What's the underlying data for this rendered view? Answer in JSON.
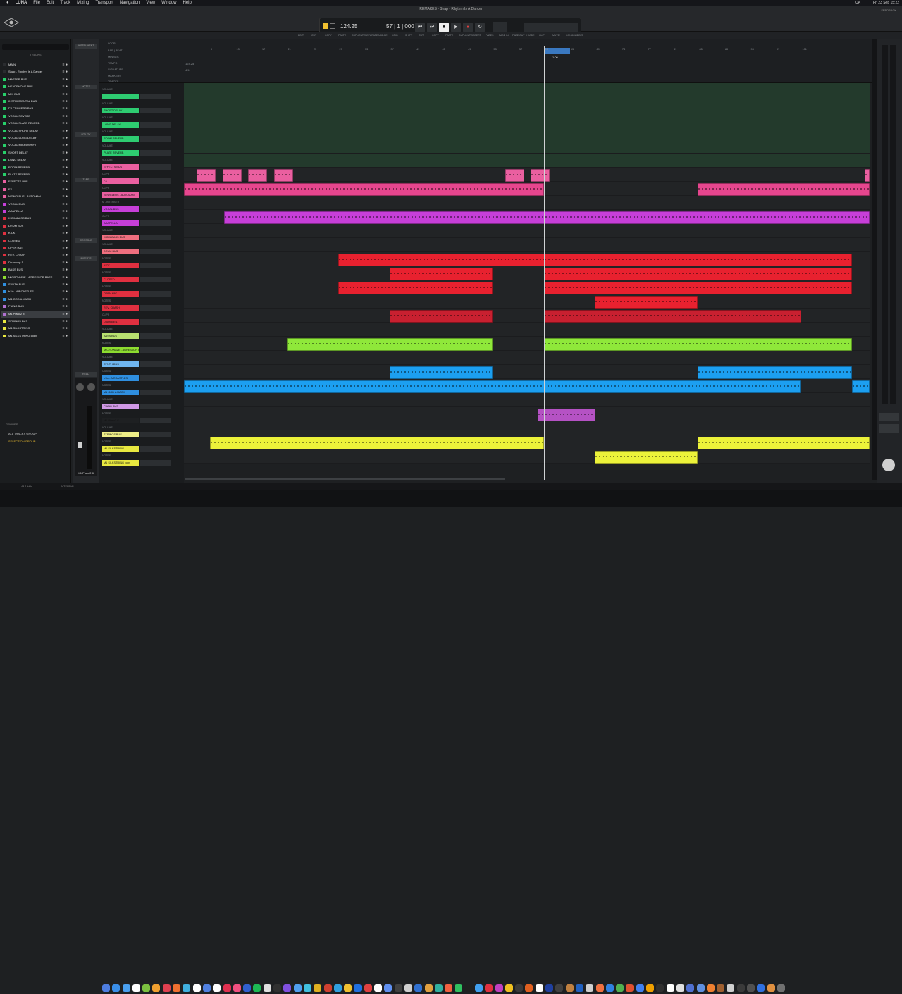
{
  "menu": {
    "apple": "",
    "app": "LUNA",
    "items": [
      "File",
      "Edit",
      "Track",
      "Mixing",
      "Transport",
      "Navigation",
      "View",
      "Window",
      "Help"
    ],
    "right": [
      "UA",
      "Fri 23 Sep  15:22"
    ]
  },
  "window": {
    "title": "REMAKES - Snap - Rhythm Is A Dancer",
    "feedback": "FEEDBACK"
  },
  "mode": {
    "label": "EDIT"
  },
  "transport": {
    "tempo": "124.25",
    "position": "57 | 1 | 000",
    "tooltip": "Play"
  },
  "edit_tools": [
    "EDIT",
    "CUT",
    "COPY",
    "PASTE",
    "DUPLICATE",
    "SEPARATE",
    "NUDGE",
    "GRID",
    "SHIFT",
    "CUT",
    "COPY",
    "PASTE",
    "DUPLICATE",
    "INSERT",
    "FADES",
    "FADE IN",
    "FADE OUT",
    "X FADE",
    "CLIP",
    "MUTE",
    "CONSOLIDATE"
  ],
  "sidebar": {
    "search_placeholder": "",
    "tracks_heading": "TRACKS",
    "groups_heading": "GROUPS",
    "groups": [
      "ALL TRACKS GROUP",
      "SELECTION GROUP"
    ]
  },
  "track_list": [
    {
      "name": "MAIN",
      "color": "#2a2c2f"
    },
    {
      "name": "Snap - Rhythm Is A Dancer",
      "color": "#2a2c2f"
    },
    {
      "name": "MASTER BUS",
      "color": "#27d06a"
    },
    {
      "name": "HEADPHONE BUS",
      "color": "#27d06a"
    },
    {
      "name": "MIX BUS",
      "color": "#27d06a"
    },
    {
      "name": "INSTRUMENTAL BUS",
      "color": "#27d06a"
    },
    {
      "name": "FX PROCESS BUS",
      "color": "#27d06a"
    },
    {
      "name": "VOCAL REVERB",
      "color": "#27d06a"
    },
    {
      "name": "VOCAL PLATE REVERB",
      "color": "#27d06a"
    },
    {
      "name": "VOCAL SHORT DELAY",
      "color": "#27d06a"
    },
    {
      "name": "VOCAL LONG DELAY",
      "color": "#27d06a"
    },
    {
      "name": "VOCAL MICROSHIFT",
      "color": "#27d06a"
    },
    {
      "name": "SHORT DELAY",
      "color": "#27d06a"
    },
    {
      "name": "LONG DELAY",
      "color": "#27d06a"
    },
    {
      "name": "ROOM REVERB",
      "color": "#27d06a"
    },
    {
      "name": "PLATE REVERB",
      "color": "#27d06a"
    },
    {
      "name": "EFFECTS BUS",
      "color": "#ea5fa0"
    },
    {
      "name": "FX",
      "color": "#ea5fa0"
    },
    {
      "name": "NEWCLEUS - AUTOMAN",
      "color": "#ea5fa0"
    },
    {
      "name": "VOCAL BUS",
      "color": "#c63fd8"
    },
    {
      "name": "ACAPELLA",
      "color": "#c63fd8"
    },
    {
      "name": "KICK&BASS BUS",
      "color": "#e03040"
    },
    {
      "name": "DRUM BUS",
      "color": "#e03040"
    },
    {
      "name": "KICK",
      "color": "#e03040"
    },
    {
      "name": "CLOSED",
      "color": "#e03040"
    },
    {
      "name": "OPEN HAT",
      "color": "#e03040"
    },
    {
      "name": "REV. CRASH",
      "color": "#e03040"
    },
    {
      "name": "Drumloop 1",
      "color": "#e03040"
    },
    {
      "name": "BASS BUS",
      "color": "#8ddc30"
    },
    {
      "name": "MICROWAVE - AGRESSOR BASS",
      "color": "#8ddc30"
    },
    {
      "name": "SYNTH BUS",
      "color": "#2f8fe0"
    },
    {
      "name": "b1le - AIRCASTLES",
      "color": "#2f8fe0"
    },
    {
      "name": "M1 GOD A MACH",
      "color": "#2f8fe0"
    },
    {
      "name": "PIANO BUS",
      "color": "#b070d0"
    },
    {
      "name": "M1 Piano2 8'",
      "color": "#b070d0"
    },
    {
      "name": "STRINGS BUS",
      "color": "#e8e840"
    },
    {
      "name": "M1 SILKSTRING",
      "color": "#e8e840"
    },
    {
      "name": "M1 SILKSTRING copy",
      "color": "#e8e840"
    }
  ],
  "side_buttons": [
    "INSTRUMENT",
    "NOTES",
    "UTILITY",
    "TAPE",
    "CONSOLE",
    "INSERTS",
    "READ"
  ],
  "selected_strip": "M1 Piano2 8'",
  "ruler": {
    "labels": [
      "LOOP",
      "BAR | BEAT",
      "MIN:SEC",
      "TEMPO",
      "SIGNATURE",
      "MARKERS",
      "TRACKS"
    ],
    "bars": [
      "9",
      "13",
      "17",
      "21",
      "25",
      "29",
      "33",
      "37",
      "41",
      "45",
      "49",
      "53",
      "57",
      "61",
      "65",
      "69",
      "73",
      "77",
      "81",
      "85",
      "89",
      "93",
      "97",
      "101"
    ],
    "tempo_value": "124.25",
    "signature_value": "4/4",
    "minsec": "1:00"
  },
  "track_headers": [
    {
      "name": "",
      "color": "#2ecc71",
      "sub": "VOLUME"
    },
    {
      "name": "SHORT DELAY",
      "color": "#2ecc71",
      "sub": "VOLUME"
    },
    {
      "name": "LONG DELAY",
      "color": "#2ecc71",
      "sub": "VOLUME"
    },
    {
      "name": "ROOM REVERB",
      "color": "#2ecc71",
      "sub": "VOLUME"
    },
    {
      "name": "PLATE REVERB",
      "color": "#2ecc71",
      "sub": "VOLUME"
    },
    {
      "name": "EFFECTS BUS",
      "color": "#ea5fa0",
      "sub": "VOLUME"
    },
    {
      "name": "FX",
      "color": "#ea5fa0",
      "sub": "CLIPS"
    },
    {
      "name": "NEWCLEUS - AUTOMAN",
      "color": "#ea5fa0",
      "sub": "CLIPS"
    },
    {
      "name": "VOCAL BUS",
      "color": "#c63fd8",
      "sub": "M - INTENSITY"
    },
    {
      "name": "ACAPELLA",
      "color": "#c63fd8",
      "sub": "CLIPS"
    },
    {
      "name": "KICK&BASS BUS",
      "color": "#ef6f7f",
      "sub": "VOLUME"
    },
    {
      "name": "DRUM BUS",
      "color": "#ef6f7f",
      "sub": "VOLUME"
    },
    {
      "name": "KICK",
      "color": "#e03040",
      "sub": "NOTES"
    },
    {
      "name": "CLOSED",
      "color": "#e03040",
      "sub": "NOTES"
    },
    {
      "name": "OPEN HAT",
      "color": "#e03040",
      "sub": "NOTES"
    },
    {
      "name": "REV. CRASH",
      "color": "#e03040",
      "sub": "NOTES"
    },
    {
      "name": "Drumloop 1",
      "color": "#e03040",
      "sub": "CLIPS"
    },
    {
      "name": "BASS BUS",
      "color": "#b8e070",
      "sub": "VOLUME"
    },
    {
      "name": "MICROWAVE - AGRESSOR BASS",
      "color": "#8ddc30",
      "sub": "NOTES"
    },
    {
      "name": "SYNTH BUS",
      "color": "#6fb5ef",
      "sub": "VOLUME"
    },
    {
      "name": "b1le - AIRCASTLES",
      "color": "#2f8fe0",
      "sub": "NOTES"
    },
    {
      "name": "M1 GOD A MACH",
      "color": "#2f8fe0",
      "sub": "NOTES"
    },
    {
      "name": "PIANO BUS",
      "color": "#d098e6",
      "sub": "VOLUME"
    },
    {
      "name": "M1 Piano2 8'",
      "color": "#1e2022",
      "sub": "NOTES"
    },
    {
      "name": "STRINGS BUS",
      "color": "#eeee88",
      "sub": "VOLUME"
    },
    {
      "name": "M1 SILKSTRING",
      "color": "#e8e840",
      "sub": "NOTES"
    },
    {
      "name": "M1 SILKSTRING copy",
      "color": "#e8e840",
      "sub": "NOTES"
    }
  ],
  "bottom": {
    "sample_rate": "44.1 kHz",
    "clock": "INTERNAL"
  }
}
